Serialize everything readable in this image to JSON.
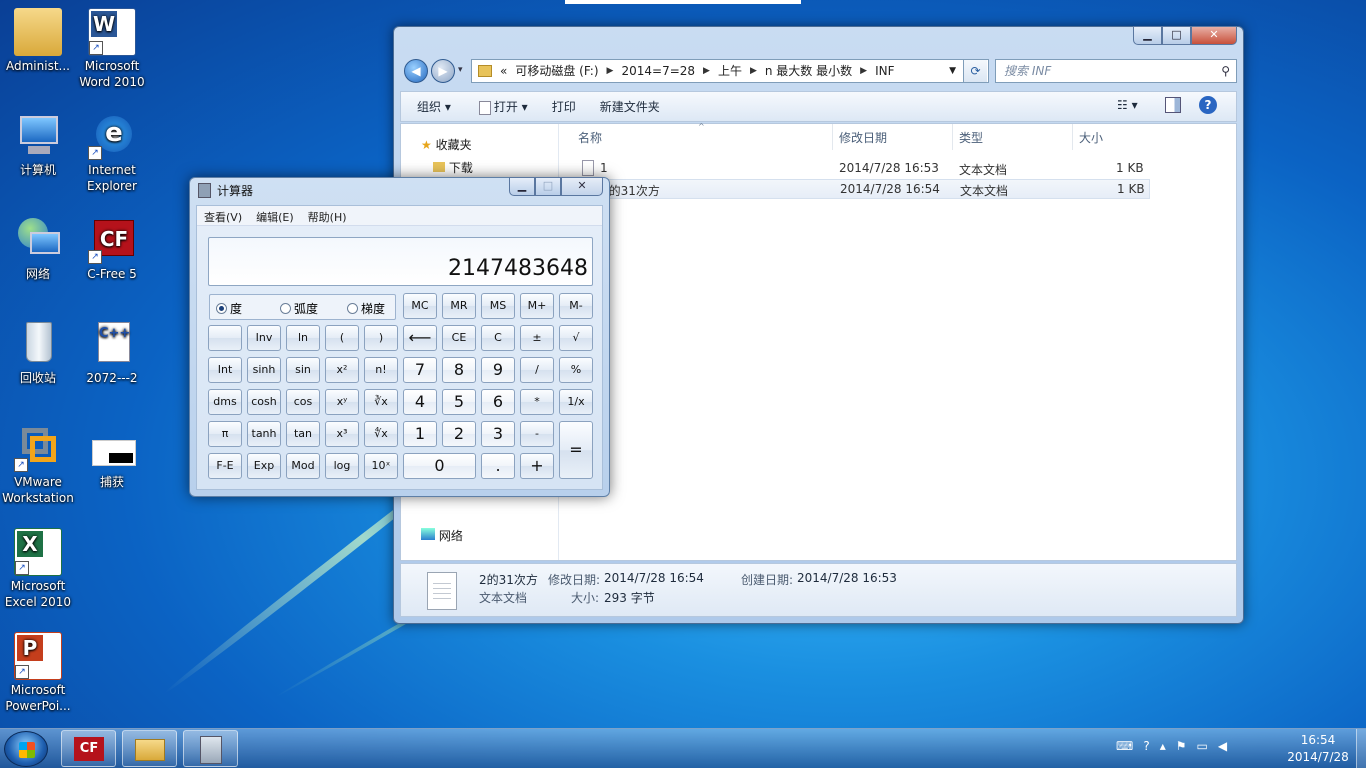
{
  "desktop": {
    "icons": [
      {
        "label": "Administ...",
        "icon": "user-folder-icon"
      },
      {
        "label": "Microsoft Word 2010",
        "icon": "word-icon"
      },
      {
        "label": "计算机",
        "icon": "computer-icon"
      },
      {
        "label": "Internet Explorer",
        "icon": "ie-icon"
      },
      {
        "label": "网络",
        "icon": "network-icon"
      },
      {
        "label": "C-Free 5",
        "icon": "cfree-icon"
      },
      {
        "label": "回收站",
        "icon": "recycle-bin-icon"
      },
      {
        "label": "2072---2",
        "icon": "cpp-file-icon"
      },
      {
        "label": "VMware Workstation",
        "icon": "vmware-icon"
      },
      {
        "label": "捕获",
        "icon": "image-file-icon"
      },
      {
        "label": "Microsoft Excel 2010",
        "icon": "excel-icon"
      },
      {
        "label": "Microsoft PowerPoi...",
        "icon": "powerpoint-icon"
      }
    ]
  },
  "explorer": {
    "address": {
      "prefix": "«",
      "crumbs": [
        "可移动磁盘 (F:)",
        "2014=7=28",
        "上午",
        "n 最大数 最小数",
        "INF"
      ]
    },
    "search_placeholder": "搜索 INF",
    "toolbar": {
      "organize": "组织 ▾",
      "open": "打开 ▾",
      "print": "打印",
      "new_folder": "新建文件夹"
    },
    "nav": {
      "favorites": "收藏夹",
      "downloads": "下载",
      "network": "网络"
    },
    "columns": {
      "name": "名称",
      "modified": "修改日期",
      "type": "类型",
      "size": "大小"
    },
    "files": [
      {
        "name": "1",
        "modified": "2014/7/28 16:53",
        "type": "文本文档",
        "size": "1 KB"
      },
      {
        "name": "2的31次方",
        "modified": "2014/7/28 16:54",
        "type": "文本文档",
        "size": "1 KB"
      }
    ],
    "details": {
      "name": "2的31次方",
      "modified_label": "修改日期:",
      "modified": "2014/7/28 16:54",
      "created_label": "创建日期:",
      "created": "2014/7/28 16:53",
      "type": "文本文档",
      "size_label": "大小:",
      "size": "293 字节"
    }
  },
  "calculator": {
    "title": "计算器",
    "menu": [
      "查看(V)",
      "编辑(E)",
      "帮助(H)"
    ],
    "display": "2147483648",
    "angle_modes": [
      "度",
      "弧度",
      "梯度"
    ],
    "selected_angle": "度",
    "memory": [
      "MC",
      "MR",
      "MS",
      "M+",
      "M-"
    ],
    "rows": [
      [
        "",
        "Inv",
        "ln",
        "(",
        ")",
        "⟵",
        "CE",
        "C",
        "±",
        "√"
      ],
      [
        "Int",
        "sinh",
        "sin",
        "x²",
        "n!",
        "7",
        "8",
        "9",
        "/",
        "%"
      ],
      [
        "dms",
        "cosh",
        "cos",
        "xʸ",
        "∛x",
        "4",
        "5",
        "6",
        "*",
        "1/x"
      ],
      [
        "π",
        "tanh",
        "tan",
        "x³",
        "∜x",
        "1",
        "2",
        "3",
        "-",
        "="
      ],
      [
        "F-E",
        "Exp",
        "Mod",
        "log",
        "10ˣ",
        "0",
        ".",
        "+"
      ]
    ]
  },
  "taskbar": {
    "apps": [
      "C-Free",
      "Windows Explorer",
      "计算器"
    ],
    "time": "16:54",
    "date": "2014/7/28"
  }
}
